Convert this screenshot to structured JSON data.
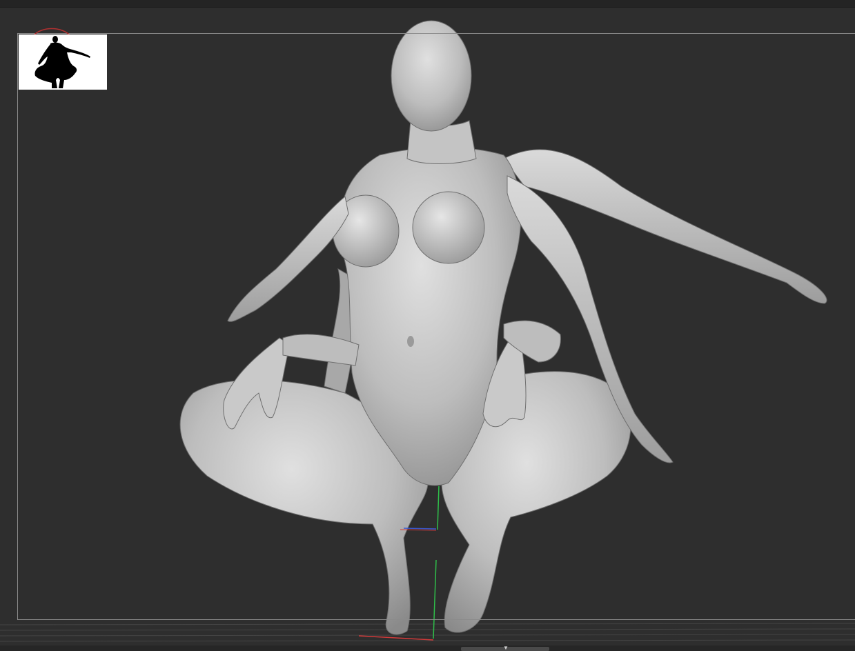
{
  "viewport": {
    "background_color": "#2e2e2e",
    "frame_color": "#8b8b8b",
    "model_color": "#c9c9c9"
  },
  "reference_thumbnail": {
    "icon": "crouching-figure-silhouette-icon",
    "background_color": "#ffffff"
  },
  "axis_gizmo": {
    "x_color": "#d23a3a",
    "y_color": "#2fbf4a",
    "z_color": "#3a5ad2"
  },
  "bottom_bar": {
    "handle_icon": "chevron-down-icon",
    "handle_glyph": "▼"
  }
}
